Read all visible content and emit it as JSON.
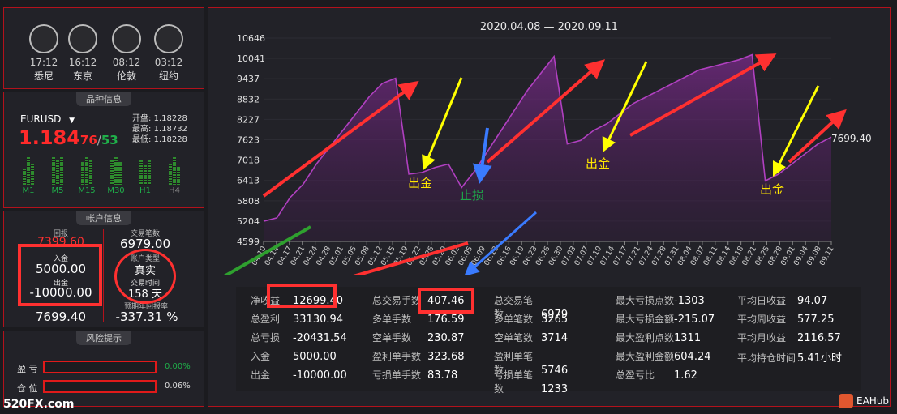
{
  "clocks": [
    {
      "time": "17:12",
      "city": "悉尼"
    },
    {
      "time": "16:12",
      "city": "东京"
    },
    {
      "time": "08:12",
      "city": "伦敦"
    },
    {
      "time": "03:12",
      "city": "纽约"
    }
  ],
  "symbol": {
    "section_title": "品种信息",
    "name": "EURUSD",
    "price_big": "1.184",
    "price_sub1": "76",
    "price_sep": "/",
    "price_sub2": "53",
    "open_label": "开盘:",
    "open": "1.18228",
    "high_label": "最高:",
    "high": "1.18732",
    "low_label": "最低:",
    "low": "1.18228",
    "timeframes": [
      "M1",
      "M5",
      "M15",
      "M30",
      "H1",
      "H4"
    ]
  },
  "account": {
    "section_title": "帐户信息",
    "return_label": "回报",
    "return_value": "7399.60",
    "deposit_label": "入金",
    "deposit": "5000.00",
    "withdraw_label": "出金",
    "withdraw": "-10000.00",
    "net_label": "净值",
    "net": "7699.40",
    "trades_label": "交易笔数",
    "trades": "6979.00",
    "type_label": "账户类型",
    "type": "真实",
    "time_label": "交易时间",
    "days": "158 天",
    "annual_label": "预期年回报率",
    "annual": "-337.31 %"
  },
  "risk": {
    "section_title": "风险提示",
    "profit_label": "盈 亏",
    "profit_pct": "0.00%",
    "position_label": "仓 位",
    "position_pct": "0.06%"
  },
  "chart_data": {
    "type": "area",
    "title": "2020.04.08 — 2020.09.11",
    "y_ticks": [
      10646,
      10041,
      9437,
      8832,
      8227,
      7623,
      7018,
      6413,
      5808,
      5204,
      4599
    ],
    "ylim": [
      4599,
      10646
    ],
    "x_ticks": [
      "04.10",
      "04.14",
      "04.17",
      "04.21",
      "04.24",
      "04.28",
      "05.01",
      "05.05",
      "05.08",
      "05.12",
      "05.15",
      "05.19",
      "05.22",
      "05.26",
      "05.29",
      "06.02",
      "06.05",
      "06.09",
      "06.12",
      "06.16",
      "06.19",
      "06.23",
      "06.26",
      "06.30",
      "07.03",
      "07.07",
      "07.10",
      "07.14",
      "07.17",
      "07.21",
      "07.24",
      "07.28",
      "07.31",
      "08.04",
      "08.07",
      "08.11",
      "08.14",
      "08.18",
      "08.21",
      "08.25",
      "08.28",
      "09.01",
      "09.04",
      "09.08",
      "09.11"
    ],
    "series": [
      {
        "values": [
          5200,
          5300,
          5900,
          6300,
          6900,
          7400,
          7900,
          8400,
          8900,
          9300,
          9450,
          6600,
          6650,
          6800,
          6900,
          6200,
          6700,
          7300,
          7900,
          8500,
          9100,
          9600,
          10100,
          7500,
          7600,
          7900,
          8100,
          8400,
          8700,
          8900,
          9100,
          9300,
          9500,
          9700,
          9800,
          9900,
          10000,
          10150,
          6400,
          6600,
          6900,
          7200,
          7500,
          7699.4
        ]
      }
    ],
    "last_value_label": "7699.40",
    "annotations": [
      {
        "text": "出金",
        "color": "#ffe600"
      },
      {
        "text": "止损",
        "color": "#1fa64a"
      },
      {
        "text": "出金",
        "color": "#ffe600"
      },
      {
        "text": "出金",
        "color": "#ffe600"
      }
    ]
  },
  "stats": [
    [
      {
        "k": "净收益",
        "v": "12699.40"
      },
      {
        "k": "总盈利",
        "v": "33130.94"
      },
      {
        "k": "总亏损",
        "v": "-20431.54"
      },
      {
        "k": "入金",
        "v": "5000.00"
      },
      {
        "k": "出金",
        "v": "-10000.00"
      }
    ],
    [
      {
        "k": "总交易手数",
        "v": "407.46"
      },
      {
        "k": "多单手数",
        "v": "176.59"
      },
      {
        "k": "空单手数",
        "v": "230.87"
      },
      {
        "k": "盈利单手数",
        "v": "323.68"
      },
      {
        "k": "亏损单手数",
        "v": "83.78"
      }
    ],
    [
      {
        "k": "总交易笔数",
        "v": "6979"
      },
      {
        "k": "多单笔数",
        "v": "3265"
      },
      {
        "k": "空单笔数",
        "v": "3714"
      },
      {
        "k": "盈利单笔数",
        "v": "5746"
      },
      {
        "k": "亏损单笔数",
        "v": "1233"
      }
    ],
    [
      {
        "k": "最大亏损点数",
        "v": "-1303"
      },
      {
        "k": "最大亏损金额",
        "v": "-215.07"
      },
      {
        "k": "最大盈利点数",
        "v": "1311"
      },
      {
        "k": "最大盈利金额",
        "v": "604.24"
      },
      {
        "k": "总盈亏比",
        "v": "1.62"
      }
    ],
    [
      {
        "k": "平均日收益",
        "v": "94.07"
      },
      {
        "k": "平均周收益",
        "v": "577.25"
      },
      {
        "k": "平均月收益",
        "v": "2116.57"
      },
      {
        "k": "平均持仓时间",
        "v": "5.41小时"
      }
    ]
  ],
  "watermark": {
    "left": "520FX.com",
    "right": "EAHub"
  },
  "colors": {
    "accent_red": "#ff3030",
    "price_red": "#ff2a2a",
    "price_green": "#1fb04a",
    "curve": "#b040c0"
  }
}
